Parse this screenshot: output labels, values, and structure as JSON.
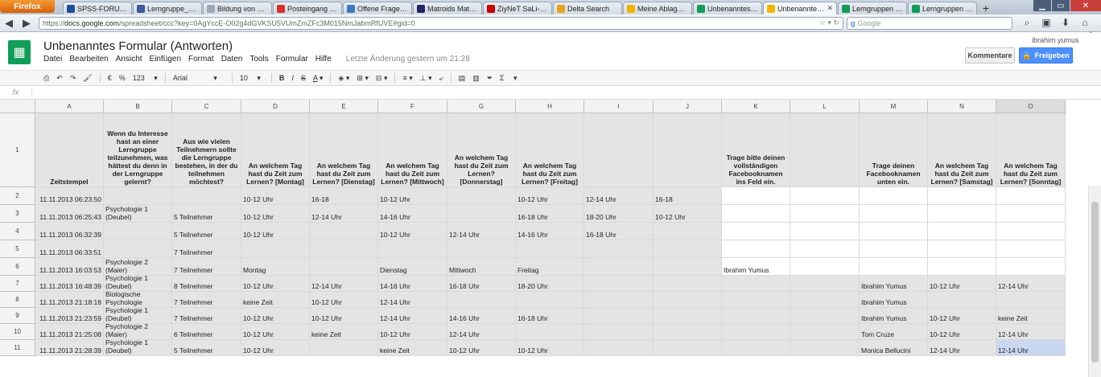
{
  "browser": {
    "app_button": "Firefox",
    "tabs": [
      {
        "label": "SPSS-FORUM.DE ...",
        "color": "#1f4e9c"
      },
      {
        "label": "Lerngruppe_1 Se...",
        "color": "#3b5998"
      },
      {
        "label": "Bildung von Gru...",
        "color": "#9aa8b8"
      },
      {
        "label": "Posteingang - yu...",
        "color": "#d93025"
      },
      {
        "label": "Offene Fragen de...",
        "color": "#3b7bbf"
      },
      {
        "label": "Matroids Mathep...",
        "color": "#222266"
      },
      {
        "label": "ZiyNeT SaLi- D...",
        "color": "#cc0000"
      },
      {
        "label": "Delta Search",
        "color": "#e8a317"
      },
      {
        "label": "Meine Ablage - G...",
        "color": "#f4b400"
      },
      {
        "label": "Unbenanntes For...",
        "color": "#0f9d58"
      },
      {
        "label": "Unbenanntes ...",
        "color": "#f4b400",
        "active": true
      },
      {
        "label": "Lerngruppen Um...",
        "color": "#0f9d58"
      },
      {
        "label": "Lerngruppen Um...",
        "color": "#0f9d58"
      }
    ],
    "new_tab": "+",
    "url_host": "docs.google.com",
    "url_prefix": "https://",
    "url_path": "/spreadsheet/ccc?key=0AgYccE-O02g4dGVKSU5VUmZmZFc3M015NmJabmRfUVE#gid=0",
    "search_engine": "g",
    "search_placeholder": "Google"
  },
  "doc": {
    "title": "Unbenanntes Formular (Antworten)",
    "menus": [
      "Datei",
      "Bearbeiten",
      "Ansicht",
      "Einfügen",
      "Format",
      "Daten",
      "Tools",
      "Formular",
      "Hilfe"
    ],
    "last_edit": "Letzte Änderung gestern um 21:28",
    "user": "ibrahim yumus",
    "comments_label": "Kommentare",
    "share_label": "Freigeben",
    "accent": "#4d90fe",
    "sheets_green": "#0f9d58"
  },
  "toolbar": {
    "currency": "€",
    "percent": "%",
    "number_format": "123",
    "font": "Arial",
    "font_size": "10",
    "bold": "B",
    "italic": "I",
    "strike": "S",
    "text_color": "A",
    "sum": "Σ"
  },
  "formula_bar": {
    "fx": "fx",
    "value": ""
  },
  "sheet": {
    "columns": [
      "A",
      "B",
      "C",
      "D",
      "E",
      "F",
      "G",
      "H",
      "I",
      "J",
      "K",
      "L",
      "M",
      "N",
      "O"
    ],
    "selected_column": "O",
    "header_row_number": "1",
    "headers": [
      "Zeitstempel",
      "Wenn du Interesse hast an einer Lerngruppe teilzunehmen, was hättest du denn in der Lerngruppe gelernt?",
      "Aus wie vielen Teilnehmern sollte die Lerngruppe bestehen, in der du teilnehmen möchtest?",
      "An welchem Tag hast du Zeit zum Lernen? [Montag]",
      "An welchem Tag hast du Zeit zum Lernen? [Dienstag]",
      "An welchem Tag hast du Zeit zum Lernen? [Mittwoch]",
      "An welchem Tag hast du Zeit zum Lernen? [Donnerstag]",
      "An welchem Tag hast du Zeit zum Lernen? [Freitag]",
      "",
      "",
      "Trage bitte deinen vollständigen Facebooknamen ins Feld ein.",
      "",
      "Trage deinen Facebooknamen unten ein.",
      "An welchem Tag hast du Zeit zum Lernen? [Samstag]",
      "An welchem Tag hast du Zeit zum Lernen? [Sonntag]"
    ],
    "rows": [
      {
        "n": "2",
        "cells": [
          "11.11.2013 06:23:50",
          "",
          "",
          "10-12 Uhr",
          "16-18",
          "10-12 Uhr",
          "",
          "10-12 Uhr",
          "12-14 Uhr",
          "16-18",
          "",
          "",
          "",
          "",
          ""
        ]
      },
      {
        "n": "3",
        "cells": [
          "11.11.2013 06:25:43",
          "Psychologie 1 (Deubel)",
          "5 Teilnehmer",
          "10-12 Uhr",
          "12-14 Uhr",
          "14-16 Uhr",
          "",
          "16-18 Uhr",
          "18-20 Uhr",
          "10-12 Uhr",
          "",
          "",
          "",
          "",
          ""
        ]
      },
      {
        "n": "4",
        "cells": [
          "11.11.2013 06:32:39",
          "",
          "5 Teilnehmer",
          "10-12 Uhr",
          "",
          "10-12 Uhr",
          "12-14 Uhr",
          "14-16 Uhr",
          "16-18 Uhr",
          "",
          "",
          "",
          "",
          "",
          ""
        ]
      },
      {
        "n": "5",
        "cells": [
          "11.11.2013 06:33:51",
          "",
          "7 Teilnehmer",
          "",
          "",
          "",
          "",
          "",
          "",
          "",
          "",
          "",
          "",
          "",
          ""
        ]
      },
      {
        "n": "6",
        "cells": [
          "11.11.2013 16:03:53",
          "Psychologie 2 (Maier)",
          "7 Teilnehmer",
          "Montag",
          "",
          "Dienstag",
          "Mittwoch",
          "Freitag",
          "",
          "",
          "Ibrahim Yumus",
          "",
          "",
          "",
          ""
        ]
      },
      {
        "n": "7",
        "cells": [
          "11.11.2013 16:48:39",
          "Psychologie 1 (Deubel)",
          "8 Teilnehmer",
          "10-12 Uhr",
          "12-14 Uhr",
          "14-16 Uhr",
          "16-18 Uhr",
          "18-20 Uhr",
          "",
          "",
          "",
          "",
          "Ibrahim Yumus",
          "10-12 Uhr",
          "12-14 Uhr"
        ]
      },
      {
        "n": "8",
        "cells": [
          "11.11.2013 21:18:18",
          "Biologische Psychologie",
          "7 Teilnehmer",
          "keine Zeit",
          "10-12 Uhr",
          "12-14 Uhr",
          "",
          "",
          "",
          "",
          "",
          "",
          "Ibrahim Yumus",
          "",
          ""
        ]
      },
      {
        "n": "9",
        "cells": [
          "11.11.2013 21:23:59",
          "Psychologie 1 (Deubel)",
          "7 Teilnehmer",
          "10-12 Uhr",
          "10-12 Uhr",
          "12-14 Uhr",
          "14-16 Uhr",
          "16-18 Uhr",
          "",
          "",
          "",
          "",
          "Ibrahim Yumus",
          "10-12 Uhr",
          "keine Zeit"
        ]
      },
      {
        "n": "10",
        "cells": [
          "11.11.2013 21:25:08",
          "Psychologie 2 (Maier)",
          "6 Teilnehmer",
          "10-12 Uhr",
          "keine Zeit",
          "10-12 Uhr",
          "12-14 Uhr",
          "",
          "",
          "",
          "",
          "",
          "Tom Cruze",
          "10-12 Uhr",
          "12-14 Uhr"
        ]
      },
      {
        "n": "11",
        "cells": [
          "11.11.2013 21:28:39",
          "Psychologie 1 (Deubel)",
          "5 Teilnehmer",
          "10-12 Uhr",
          "",
          "keine Zeit",
          "10-12 Uhr",
          "10-12 Uhr",
          "",
          "",
          "",
          "",
          "Monica Bellucini",
          "12-14 Uhr",
          "12-14 Uhr"
        ]
      }
    ]
  }
}
